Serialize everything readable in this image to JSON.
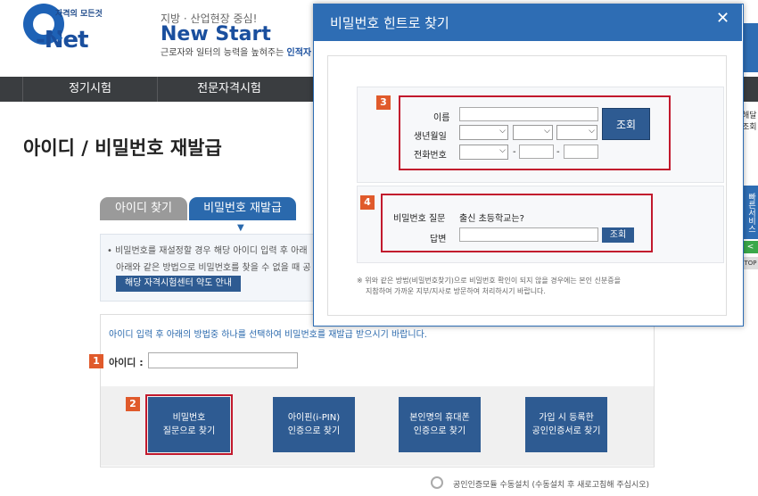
{
  "header": {
    "logo_small_text": "자격의 모든것",
    "logo_name": "-Net",
    "slogan_sub": "지방 · 산업현장 중심!",
    "slogan_main": "New Start",
    "slogan_desc": "근로자와 일터의 능력을 높혀주는",
    "slogan_desc_highlight": "인적자"
  },
  "nav": {
    "items": [
      "정기시험",
      "전문자격시험"
    ]
  },
  "page": {
    "title": "아이디 / 비밀번호 재발급",
    "tabs": [
      "아이디 찾기",
      "비밀번호 재발급"
    ],
    "notice_line1": "• 비밀번호를 재설정할 경우 해당 아이디 입력 후 아래",
    "notice_line2": "아래와 같은 방법으로 비밀번호를 찾을 수 없을 때 공",
    "notice_button": "해당 자격시험센터 약도 안내",
    "method_intro": "아이디 입력 후 아래의 방법중 하나를 선택하여 비밀번호를 재발급 받으시기 바랍니다.",
    "step1_number": "1",
    "id_label": "아이디 :",
    "step2_number": "2",
    "methods": [
      "비밀번호\n질문으로 찾기",
      "아이핀(i-PIN)\n인증으로 찾기",
      "본인명의 휴대폰\n인증으로 찾기",
      "가입 시 등록한\n공인인증서로 찾기"
    ],
    "cert_note": "공인인증모듈 수동설치 (수동설치 후 새로고침해 주십시오)"
  },
  "right_rail": {
    "label": "해달조회",
    "quick": "빠른서비스",
    "arrow": "<",
    "top": "TOP"
  },
  "modal": {
    "title": "비밀번호 힌트로 찾기",
    "close_symbol": "✕",
    "step3_number": "3",
    "name_label": "이름",
    "birth_label": "생년월일",
    "phone_label": "전화번호",
    "lookup_button": "조회",
    "phone_separator": "-",
    "step4_number": "4",
    "question_label": "비밀번호 질문",
    "question_value": "출신 초등학교는?",
    "answer_label": "답변",
    "answer_button": "조회",
    "footnote_line1": "※ 위와 같은 방법(비밀번호찾기)으로 비밀번호 확인이 되지 않을 경우에는 본인 신분증을",
    "footnote_line2": "지참하여 가까운 지부/지사로 방문하여 처리하시기 바랍니다."
  }
}
